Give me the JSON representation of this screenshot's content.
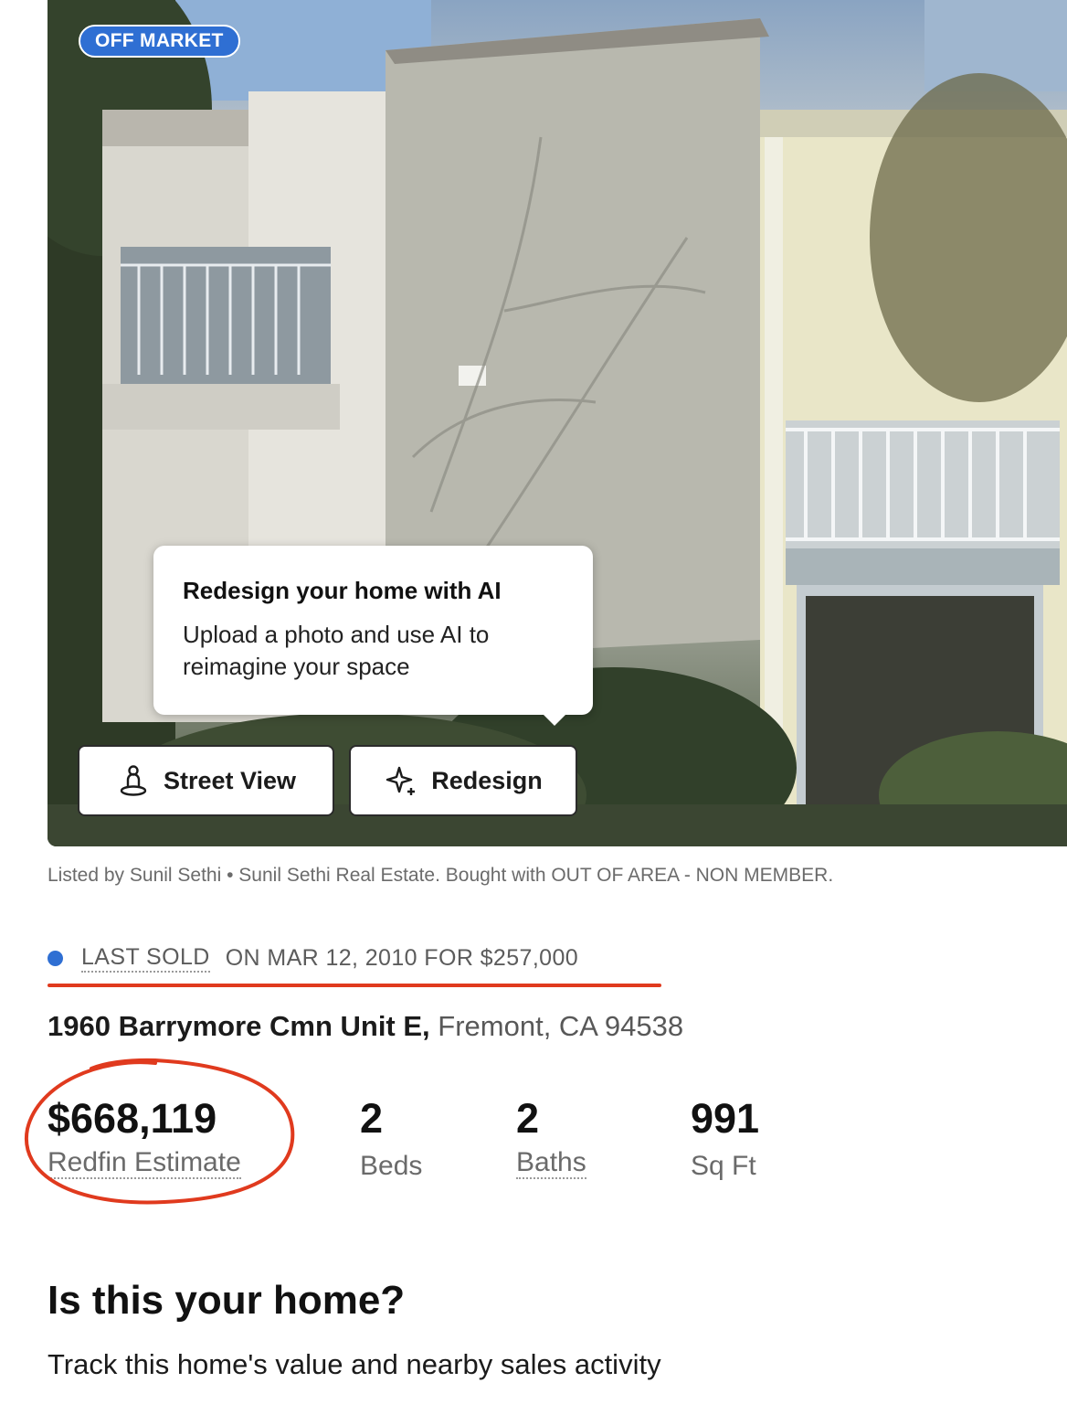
{
  "hero": {
    "badge": "OFF MARKET",
    "tooltip": {
      "title": "Redesign your home with AI",
      "body": "Upload a photo and use AI to reimagine your space"
    },
    "buttons": {
      "street_view": "Street View",
      "redesign": "Redesign"
    }
  },
  "listing": {
    "listed_by": "Listed by Sunil Sethi • Sunil Sethi Real Estate. Bought with OUT OF AREA - NON MEMBER.",
    "sold_label": "LAST SOLD",
    "sold_detail": "ON MAR 12, 2010 FOR $257,000",
    "address_street": "1960 Barrymore Cmn Unit E,",
    "address_city": "Fremont, CA 94538"
  },
  "stats": {
    "price": {
      "value": "$668,119",
      "label": "Redfin Estimate"
    },
    "beds": {
      "value": "2",
      "label": "Beds"
    },
    "baths": {
      "value": "2",
      "label": "Baths"
    },
    "sqft": {
      "value": "991",
      "label": "Sq Ft"
    }
  },
  "cta": {
    "title": "Is this your home?",
    "body": "Track this home's value and nearby sales activity"
  },
  "colors": {
    "accent_blue": "#2f6fd3",
    "annotation_red": "#e03a1e"
  }
}
